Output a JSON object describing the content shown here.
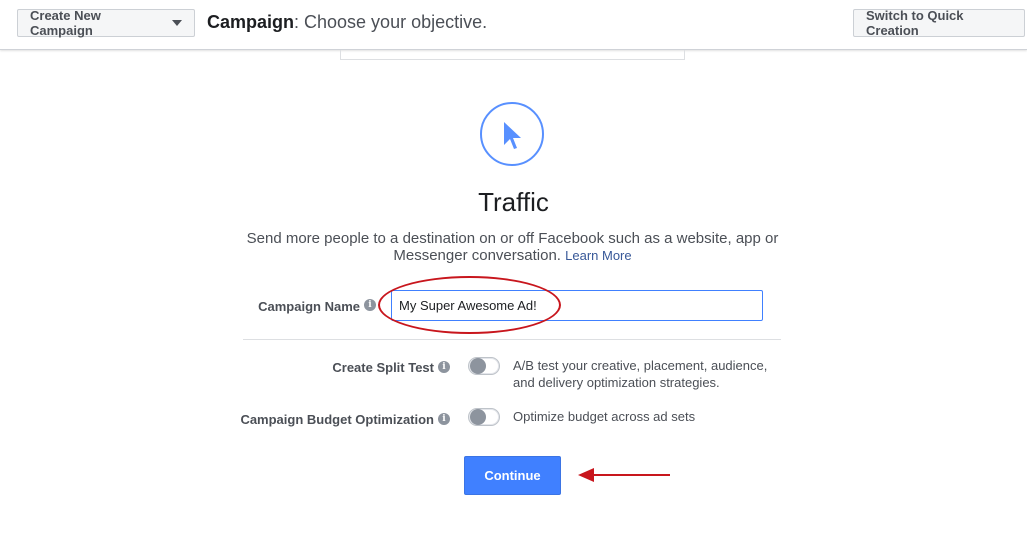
{
  "header": {
    "create_button_label": "Create New Campaign",
    "title_bold": "Campaign",
    "title_rest": ": Choose your objective.",
    "quick_creation_label": "Switch to Quick Creation"
  },
  "objective": {
    "icon": "cursor-arrow-icon",
    "title": "Traffic",
    "description": "Send more people to a destination on or off Facebook such as a website, app or Messenger conversation.",
    "learn_more_label": "Learn More"
  },
  "form": {
    "campaign_name_label": "Campaign Name",
    "campaign_name_value": "My Super Awesome Ad!",
    "split_test_label": "Create Split Test",
    "split_test_description": "A/B test your creative, placement, audience, and delivery optimization strategies.",
    "split_test_enabled": false,
    "budget_optimization_label": "Campaign Budget Optimization",
    "budget_optimization_description": "Optimize budget across ad sets",
    "budget_optimization_enabled": false,
    "info_icon_glyph": "i"
  },
  "continue_label": "Continue",
  "colors": {
    "accent": "#4080ff",
    "annotation_red": "#c8161d",
    "icon_blue": "#5890ff"
  }
}
